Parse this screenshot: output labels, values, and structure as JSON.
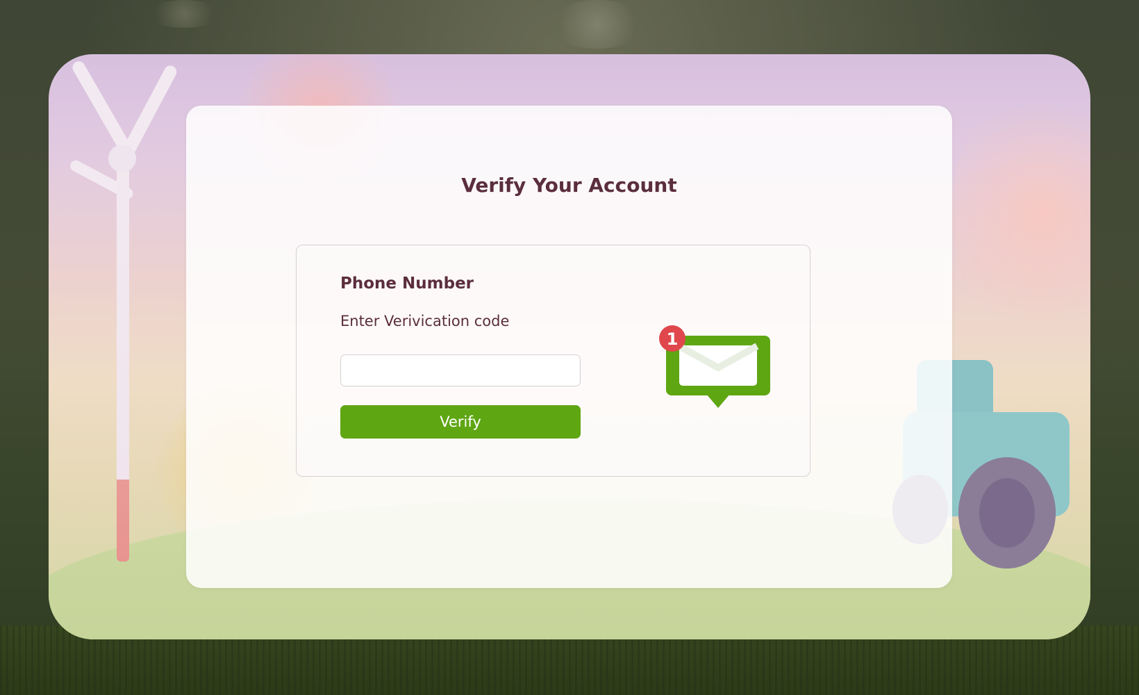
{
  "page": {
    "title": "Verify Your Account"
  },
  "form": {
    "field_title": "Phone Number",
    "field_label": "Enter Verivication code",
    "code_value": "",
    "code_placeholder": "",
    "verify_label": "Verify"
  },
  "notification": {
    "icon": "message-envelope-icon",
    "badge_count": "1"
  },
  "colors": {
    "accent": "#5fa613",
    "title_text": "#5b2e3d",
    "badge": "#e0474c"
  }
}
